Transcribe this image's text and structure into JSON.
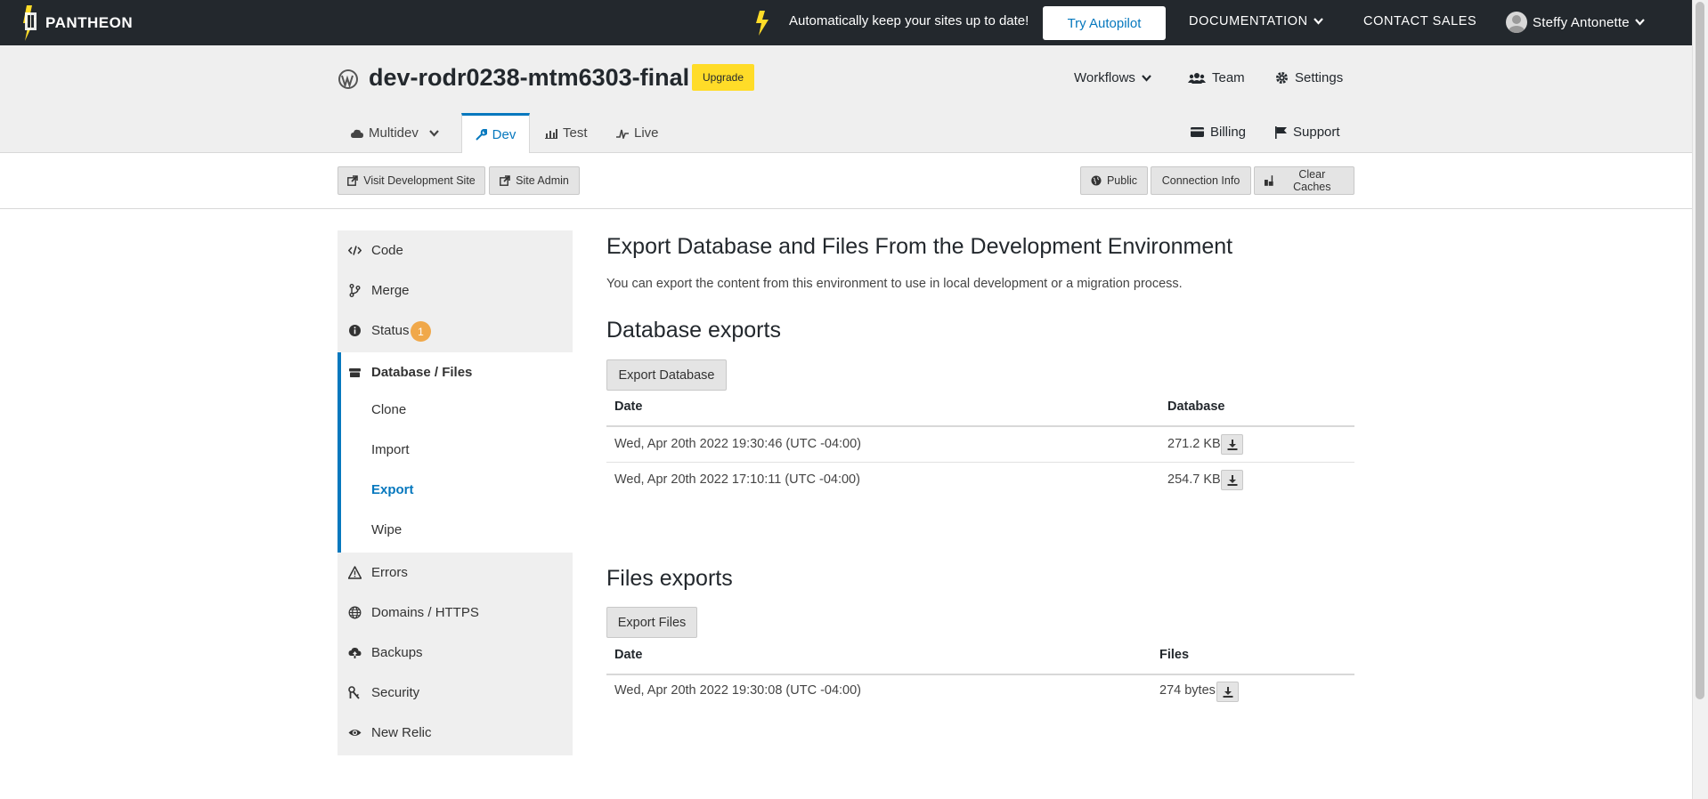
{
  "topbar": {
    "logo_text": "PANTHEON",
    "promo_text": "Automatically keep your sites up to date!",
    "autopilot_label": "Try Autopilot",
    "documentation_label": "DOCUMENTATION",
    "contact_sales_label": "CONTACT SALES",
    "user_name": "Steffy Antonette"
  },
  "site": {
    "title": "dev-rodr0238-mtm6303-final",
    "upgrade_label": "Upgrade",
    "workflows_label": "Workflows",
    "team_label": "Team",
    "settings_label": "Settings",
    "billing_label": "Billing",
    "support_label": "Support"
  },
  "env_tabs": {
    "multidev": "Multidev",
    "dev": "Dev",
    "test": "Test",
    "live": "Live"
  },
  "actions": {
    "visit_dev_site": "Visit Development Site",
    "site_admin": "Site Admin",
    "public": "Public",
    "connection_info": "Connection Info",
    "clear_caches": "Clear Caches"
  },
  "sidebar": {
    "code": "Code",
    "merge": "Merge",
    "status": "Status",
    "status_badge": "1",
    "database_files": "Database / Files",
    "clone": "Clone",
    "import": "Import",
    "export": "Export",
    "wipe": "Wipe",
    "errors": "Errors",
    "domains_https": "Domains / HTTPS",
    "backups": "Backups",
    "security": "Security",
    "new_relic": "New Relic"
  },
  "main": {
    "heading": "Export Database and Files From the Development Environment",
    "description": "You can export the content from this environment to use in local development or a migration process.",
    "db_heading": "Database exports",
    "export_db_label": "Export Database",
    "db_columns": {
      "date": "Date",
      "database": "Database"
    },
    "db_rows": [
      {
        "date": "Wed, Apr 20th 2022 19:30:46 (UTC -04:00)",
        "size": "271.2 KB"
      },
      {
        "date": "Wed, Apr 20th 2022 17:10:11 (UTC -04:00)",
        "size": "254.7 KB"
      }
    ],
    "files_heading": "Files exports",
    "export_files_label": "Export Files",
    "files_columns": {
      "date": "Date",
      "files": "Files"
    },
    "files_rows": [
      {
        "date": "Wed, Apr 20th 2022 19:30:08 (UTC -04:00)",
        "size": "274 bytes"
      }
    ]
  },
  "colors": {
    "topbar_bg": "#23282d",
    "accent_blue": "#0678be",
    "upgrade_yellow": "#ffdc28",
    "badge_orange": "#f0a84a",
    "header_gray": "#efefef"
  }
}
